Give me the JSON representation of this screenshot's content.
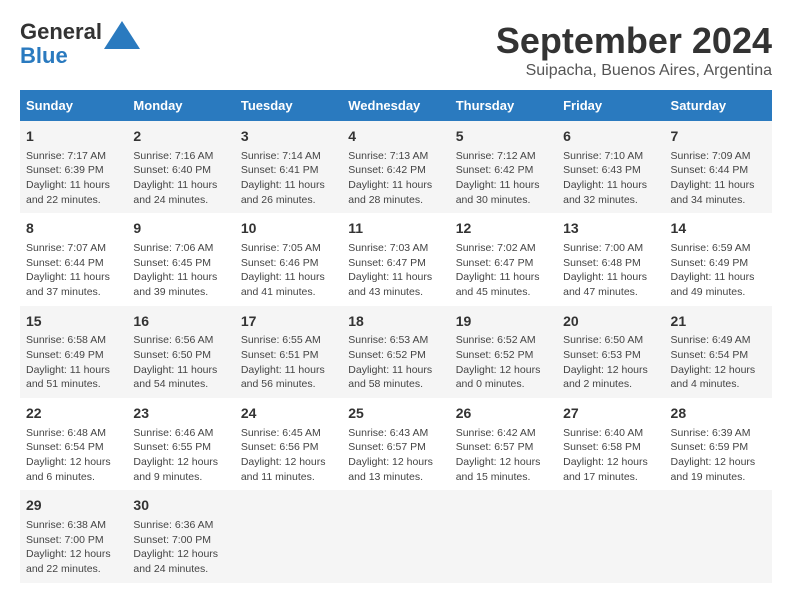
{
  "logo": {
    "line1": "General",
    "line2": "Blue"
  },
  "title": "September 2024",
  "subtitle": "Suipacha, Buenos Aires, Argentina",
  "weekdays": [
    "Sunday",
    "Monday",
    "Tuesday",
    "Wednesday",
    "Thursday",
    "Friday",
    "Saturday"
  ],
  "weeks": [
    [
      {
        "day": "1",
        "info": "Sunrise: 7:17 AM\nSunset: 6:39 PM\nDaylight: 11 hours\nand 22 minutes."
      },
      {
        "day": "2",
        "info": "Sunrise: 7:16 AM\nSunset: 6:40 PM\nDaylight: 11 hours\nand 24 minutes."
      },
      {
        "day": "3",
        "info": "Sunrise: 7:14 AM\nSunset: 6:41 PM\nDaylight: 11 hours\nand 26 minutes."
      },
      {
        "day": "4",
        "info": "Sunrise: 7:13 AM\nSunset: 6:42 PM\nDaylight: 11 hours\nand 28 minutes."
      },
      {
        "day": "5",
        "info": "Sunrise: 7:12 AM\nSunset: 6:42 PM\nDaylight: 11 hours\nand 30 minutes."
      },
      {
        "day": "6",
        "info": "Sunrise: 7:10 AM\nSunset: 6:43 PM\nDaylight: 11 hours\nand 32 minutes."
      },
      {
        "day": "7",
        "info": "Sunrise: 7:09 AM\nSunset: 6:44 PM\nDaylight: 11 hours\nand 34 minutes."
      }
    ],
    [
      {
        "day": "8",
        "info": "Sunrise: 7:07 AM\nSunset: 6:44 PM\nDaylight: 11 hours\nand 37 minutes."
      },
      {
        "day": "9",
        "info": "Sunrise: 7:06 AM\nSunset: 6:45 PM\nDaylight: 11 hours\nand 39 minutes."
      },
      {
        "day": "10",
        "info": "Sunrise: 7:05 AM\nSunset: 6:46 PM\nDaylight: 11 hours\nand 41 minutes."
      },
      {
        "day": "11",
        "info": "Sunrise: 7:03 AM\nSunset: 6:47 PM\nDaylight: 11 hours\nand 43 minutes."
      },
      {
        "day": "12",
        "info": "Sunrise: 7:02 AM\nSunset: 6:47 PM\nDaylight: 11 hours\nand 45 minutes."
      },
      {
        "day": "13",
        "info": "Sunrise: 7:00 AM\nSunset: 6:48 PM\nDaylight: 11 hours\nand 47 minutes."
      },
      {
        "day": "14",
        "info": "Sunrise: 6:59 AM\nSunset: 6:49 PM\nDaylight: 11 hours\nand 49 minutes."
      }
    ],
    [
      {
        "day": "15",
        "info": "Sunrise: 6:58 AM\nSunset: 6:49 PM\nDaylight: 11 hours\nand 51 minutes."
      },
      {
        "day": "16",
        "info": "Sunrise: 6:56 AM\nSunset: 6:50 PM\nDaylight: 11 hours\nand 54 minutes."
      },
      {
        "day": "17",
        "info": "Sunrise: 6:55 AM\nSunset: 6:51 PM\nDaylight: 11 hours\nand 56 minutes."
      },
      {
        "day": "18",
        "info": "Sunrise: 6:53 AM\nSunset: 6:52 PM\nDaylight: 11 hours\nand 58 minutes."
      },
      {
        "day": "19",
        "info": "Sunrise: 6:52 AM\nSunset: 6:52 PM\nDaylight: 12 hours\nand 0 minutes."
      },
      {
        "day": "20",
        "info": "Sunrise: 6:50 AM\nSunset: 6:53 PM\nDaylight: 12 hours\nand 2 minutes."
      },
      {
        "day": "21",
        "info": "Sunrise: 6:49 AM\nSunset: 6:54 PM\nDaylight: 12 hours\nand 4 minutes."
      }
    ],
    [
      {
        "day": "22",
        "info": "Sunrise: 6:48 AM\nSunset: 6:54 PM\nDaylight: 12 hours\nand 6 minutes."
      },
      {
        "day": "23",
        "info": "Sunrise: 6:46 AM\nSunset: 6:55 PM\nDaylight: 12 hours\nand 9 minutes."
      },
      {
        "day": "24",
        "info": "Sunrise: 6:45 AM\nSunset: 6:56 PM\nDaylight: 12 hours\nand 11 minutes."
      },
      {
        "day": "25",
        "info": "Sunrise: 6:43 AM\nSunset: 6:57 PM\nDaylight: 12 hours\nand 13 minutes."
      },
      {
        "day": "26",
        "info": "Sunrise: 6:42 AM\nSunset: 6:57 PM\nDaylight: 12 hours\nand 15 minutes."
      },
      {
        "day": "27",
        "info": "Sunrise: 6:40 AM\nSunset: 6:58 PM\nDaylight: 12 hours\nand 17 minutes."
      },
      {
        "day": "28",
        "info": "Sunrise: 6:39 AM\nSunset: 6:59 PM\nDaylight: 12 hours\nand 19 minutes."
      }
    ],
    [
      {
        "day": "29",
        "info": "Sunrise: 6:38 AM\nSunset: 7:00 PM\nDaylight: 12 hours\nand 22 minutes."
      },
      {
        "day": "30",
        "info": "Sunrise: 6:36 AM\nSunset: 7:00 PM\nDaylight: 12 hours\nand 24 minutes."
      },
      {
        "day": "",
        "info": ""
      },
      {
        "day": "",
        "info": ""
      },
      {
        "day": "",
        "info": ""
      },
      {
        "day": "",
        "info": ""
      },
      {
        "day": "",
        "info": ""
      }
    ]
  ]
}
